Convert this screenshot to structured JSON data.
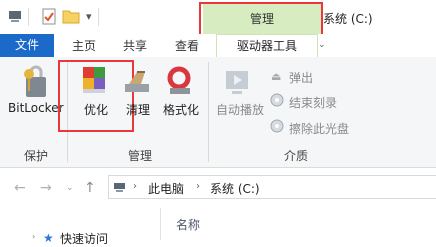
{
  "title_bar": {
    "context_group": "管理",
    "window_title": "系统 (C:)"
  },
  "tabs": {
    "file": "文件",
    "home": "主页",
    "share": "共享",
    "view": "查看",
    "drive_tools": "驱动器工具"
  },
  "ribbon": {
    "protect_group": {
      "bitlocker_label": "BitLocker",
      "group_label": "保护"
    },
    "manage_group": {
      "optimize_label": "优化",
      "cleanup_label": "清理",
      "format_label": "格式化",
      "group_label": "管理"
    },
    "media_group": {
      "autoplay_label": "自动播放",
      "eject_label": "弹出",
      "finish_burn_label": "结束刻录",
      "erase_disc_label": "擦除此光盘",
      "group_label": "介质"
    }
  },
  "address_bar": {
    "segments": [
      "此电脑",
      "系统 (C:)"
    ]
  },
  "file_list": {
    "column_name": "名称",
    "quick_access": "快速访问"
  },
  "colors": {
    "file_tab": "#1b6ac9",
    "context_tab": "#d7ecc0",
    "highlight": "#e8383b"
  }
}
